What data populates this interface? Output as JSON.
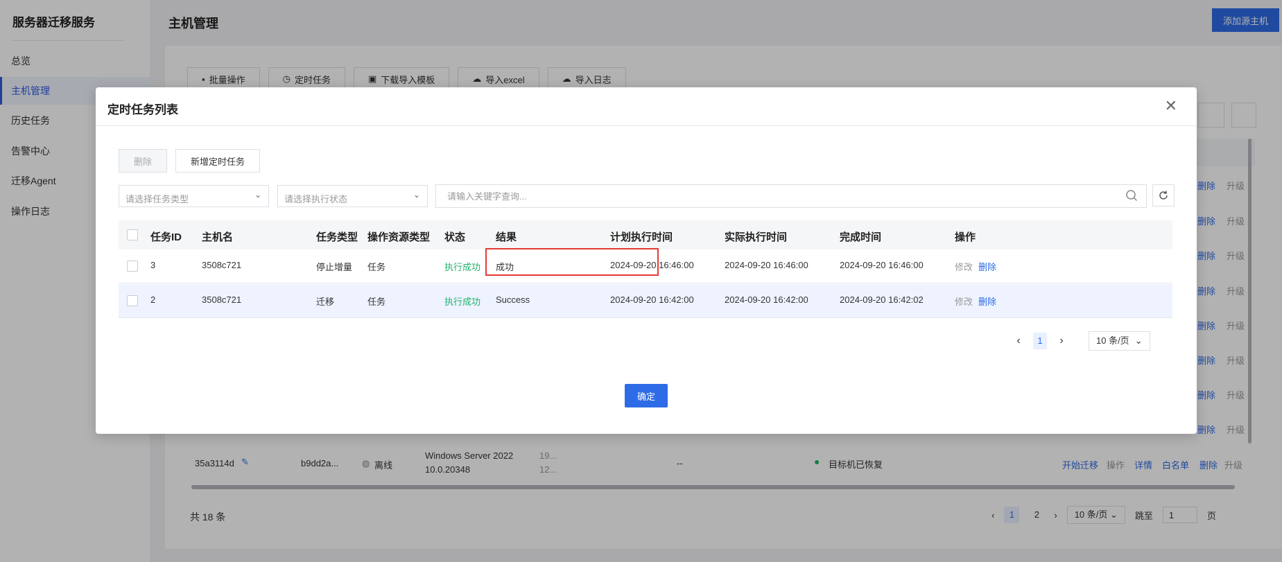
{
  "app": {
    "brand": "服务器迁移服务",
    "nav": [
      {
        "label": "总览",
        "active": false
      },
      {
        "label": "主机管理",
        "active": true
      },
      {
        "label": "历史任务",
        "active": false
      },
      {
        "label": "告警中心",
        "active": false
      },
      {
        "label": "迁移Agent",
        "active": false
      },
      {
        "label": "操作日志",
        "active": false
      }
    ],
    "page_title": "主机管理",
    "add_host_label": "添加源主机",
    "toolbar": [
      "批量操作",
      "定时任务",
      "下载导入模板",
      "导入excel",
      "导入日志"
    ],
    "row_actions": {
      "delete": "删除",
      "upgrade": "升级"
    },
    "last_row": {
      "id": "35a3114d",
      "name": "b9dd2a...",
      "status": "离线",
      "os_line1": "Windows Server 2022",
      "os_line2": "10.0.20348",
      "ip_partial1": "19...",
      "ip_partial2": "12...",
      "dash": "--",
      "recovery": "目标机已恢复",
      "actions": [
        "开始迁移",
        "操作",
        "详情",
        "白名单",
        "删除",
        "升级"
      ]
    },
    "footer": {
      "total": "共 18 条",
      "pages": [
        "1",
        "2"
      ],
      "page_size": "10 条/页",
      "jump_label": "跳至",
      "jump_value": "1",
      "page_unit": "页"
    }
  },
  "modal": {
    "title": "定时任务列表",
    "delete_label": "删除",
    "add_label": "新增定时任务",
    "task_type_placeholder": "请选择任务类型",
    "exec_status_placeholder": "请选择执行状态",
    "search_placeholder": "请输入关键字查询...",
    "columns": [
      "任务ID",
      "主机名",
      "任务类型",
      "操作资源类型",
      "状态",
      "结果",
      "计划执行时间",
      "实际执行时间",
      "完成时间",
      "操作"
    ],
    "rows": [
      {
        "id": "3",
        "host": "3508c721",
        "type": "停止增量",
        "resource": "任务",
        "status": "执行成功",
        "result": "成功",
        "plan": "2024-09-20 16:46:00",
        "actual": "2024-09-20 16:46:00",
        "done": "2024-09-20 16:46:00",
        "edit": "修改",
        "delete": "删除"
      },
      {
        "id": "2",
        "host": "3508c721",
        "type": "迁移",
        "resource": "任务",
        "status": "执行成功",
        "result": "Success",
        "plan": "2024-09-20 16:42:00",
        "actual": "2024-09-20 16:42:00",
        "done": "2024-09-20 16:42:02",
        "edit": "修改",
        "delete": "删除"
      }
    ],
    "pager": {
      "current": "1",
      "page_size": "10 条/页"
    },
    "ok_label": "确定"
  },
  "colors": {
    "accent": "#2e6be6",
    "success": "#20b26b",
    "highlight": "#e53935"
  }
}
